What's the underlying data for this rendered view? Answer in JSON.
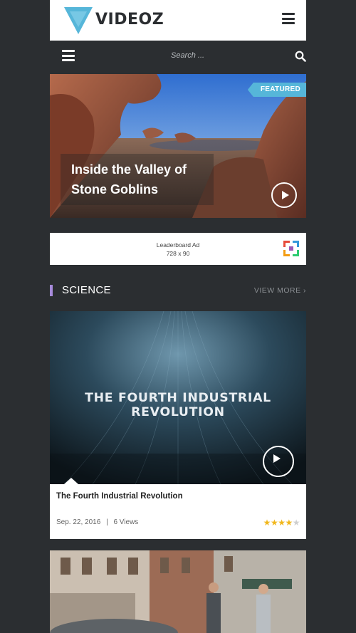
{
  "header": {
    "logo_text": "VIDEOZ"
  },
  "nav": {
    "search_placeholder": "Search ..."
  },
  "featured": {
    "tag": "FEATURED",
    "title_line1": "Inside the Valley of",
    "title_line2": "Stone Goblins"
  },
  "ad": {
    "line1": "Leaderboard Ad",
    "line2": "728 x 90"
  },
  "section": {
    "title": "SCIENCE",
    "view_more": "VIEW MORE ›"
  },
  "card": {
    "thumb_text": "THE FOURTH INDUSTRIAL REVOLUTION",
    "title": "The Fourth Industrial Revolution",
    "date": "Sep. 22, 2016",
    "separator": "|",
    "views": "6 Views",
    "rating": 4,
    "rating_max": 5
  },
  "colors": {
    "accent": "#56b6d9",
    "section_marker": "#a78bdb",
    "background": "#2b2e31",
    "star": "#f1b71c"
  }
}
